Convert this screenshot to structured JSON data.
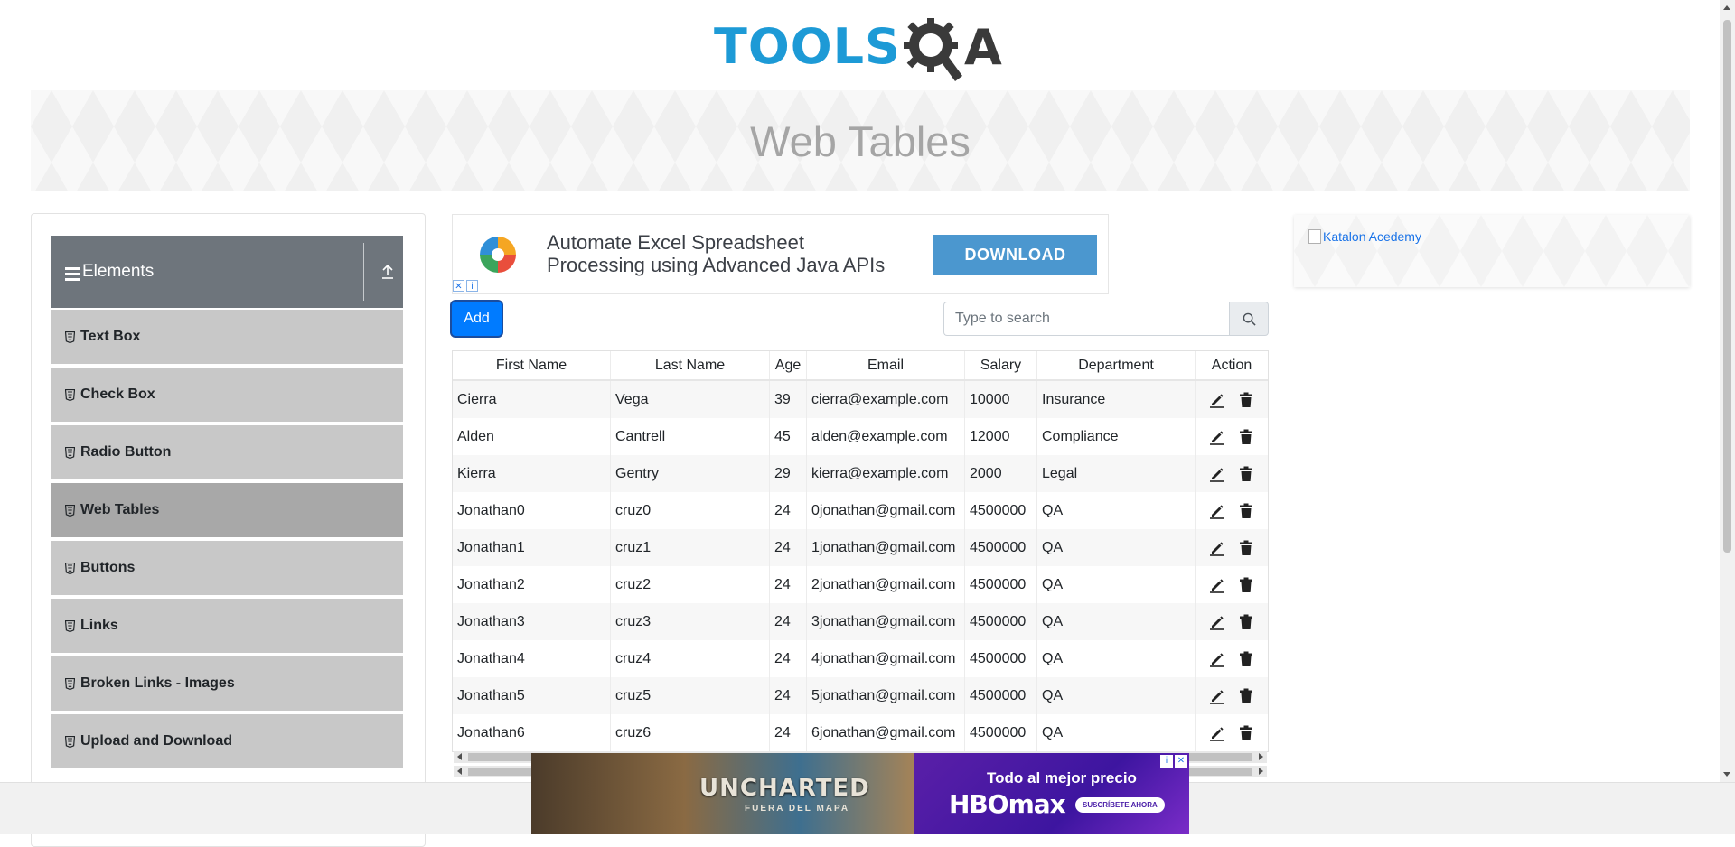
{
  "logo": {
    "brand_text": "TOOLS",
    "brand_a": "A"
  },
  "banner": {
    "title": "Web Tables"
  },
  "sidebar": {
    "group_title": "Elements",
    "items": [
      {
        "label": "Text Box",
        "active": false
      },
      {
        "label": "Check Box",
        "active": false
      },
      {
        "label": "Radio Button",
        "active": false
      },
      {
        "label": "Web Tables",
        "active": true
      },
      {
        "label": "Buttons",
        "active": false
      },
      {
        "label": "Links",
        "active": false
      },
      {
        "label": "Broken Links - Images",
        "active": false
      },
      {
        "label": "Upload and Download",
        "active": false
      }
    ]
  },
  "ad_top": {
    "line1": "Automate Excel Spreadsheet",
    "line2": "Processing using Advanced Java APIs",
    "button": "DOWNLOAD"
  },
  "toolbar": {
    "add_label": "Add"
  },
  "search": {
    "placeholder": "Type to search"
  },
  "table": {
    "headers": [
      "First Name",
      "Last Name",
      "Age",
      "Email",
      "Salary",
      "Department",
      "Action"
    ],
    "rows": [
      [
        "Cierra",
        "Vega",
        "39",
        "cierra@example.com",
        "10000",
        "Insurance"
      ],
      [
        "Alden",
        "Cantrell",
        "45",
        "alden@example.com",
        "12000",
        "Compliance"
      ],
      [
        "Kierra",
        "Gentry",
        "29",
        "kierra@example.com",
        "2000",
        "Legal"
      ],
      [
        "Jonathan0",
        "cruz0",
        "24",
        "0jonathan@gmail.com",
        "4500000",
        "QA"
      ],
      [
        "Jonathan1",
        "cruz1",
        "24",
        "1jonathan@gmail.com",
        "4500000",
        "QA"
      ],
      [
        "Jonathan2",
        "cruz2",
        "24",
        "2jonathan@gmail.com",
        "4500000",
        "QA"
      ],
      [
        "Jonathan3",
        "cruz3",
        "24",
        "3jonathan@gmail.com",
        "4500000",
        "QA"
      ],
      [
        "Jonathan4",
        "cruz4",
        "24",
        "4jonathan@gmail.com",
        "4500000",
        "QA"
      ],
      [
        "Jonathan5",
        "cruz5",
        "24",
        "5jonathan@gmail.com",
        "4500000",
        "QA"
      ],
      [
        "Jonathan6",
        "cruz6",
        "24",
        "6jonathan@gmail.com",
        "4500000",
        "QA"
      ]
    ]
  },
  "ad_right": {
    "alt_text": "Katalon Acedemy"
  },
  "bottom_ad": {
    "movie_title": "UNCHARTED",
    "movie_subtitle": "FUERA DEL MAPA",
    "tagline": "Todo al mejor precio",
    "brand": "HBOmax",
    "cta": "SUSCRÍBETE AHORA"
  },
  "colors": {
    "brand_blue": "#1d9ad6",
    "primary_button": "#007bff",
    "sidebar_header": "#6e757c"
  },
  "icons": [
    "hamburger-icon",
    "collapse-icon",
    "html5-icon",
    "search-icon",
    "edit-icon",
    "delete-icon"
  ]
}
